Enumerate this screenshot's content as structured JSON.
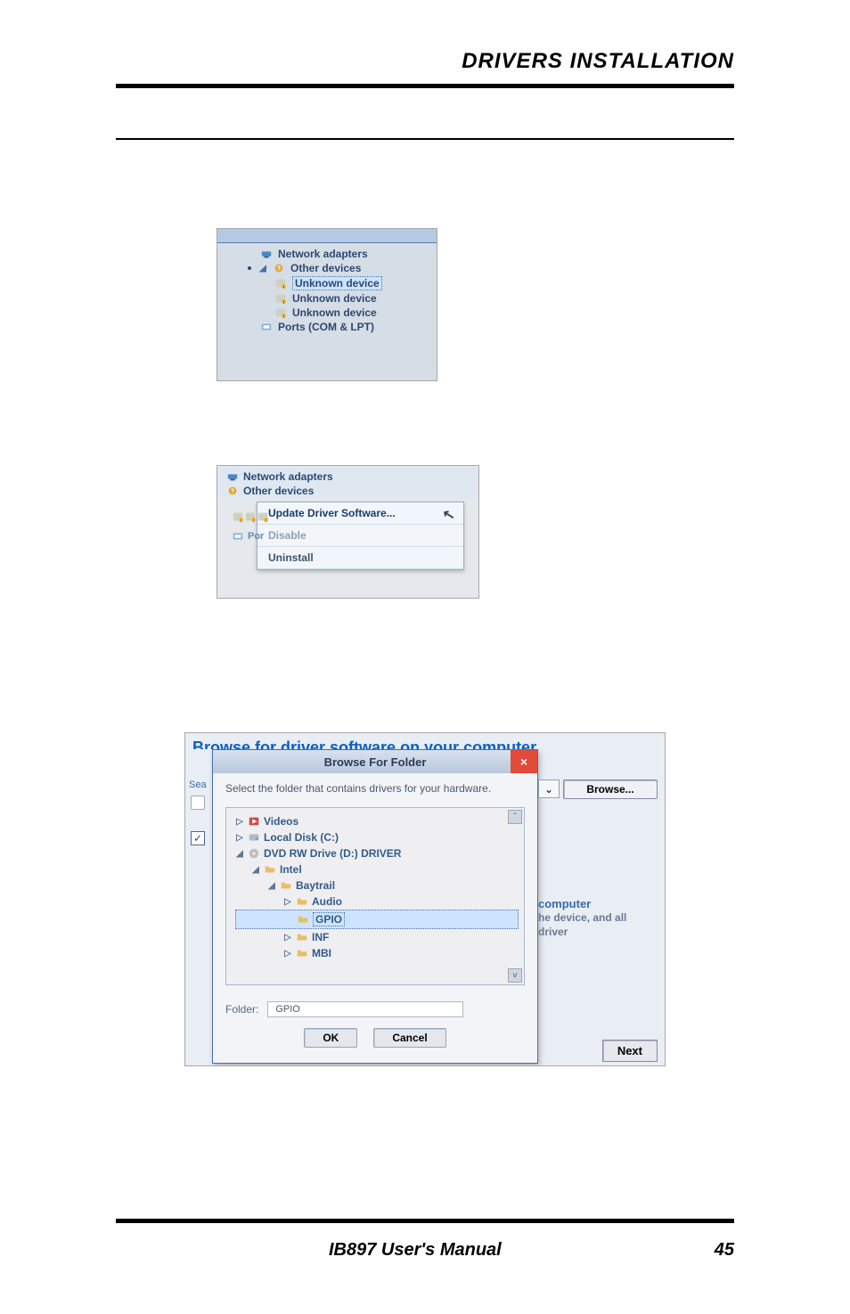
{
  "header": {
    "title": "DRIVERS INSTALLATION"
  },
  "footer": {
    "center": "IB897 User's Manual",
    "right": "45"
  },
  "img1": {
    "top_strip": " ",
    "rows": [
      {
        "twist": " ",
        "icon": "network-adapter-icon",
        "label": "Network adapters",
        "indent": 1
      },
      {
        "twist": "◢",
        "icon": "other-devices-icon",
        "label": "Other devices",
        "indent": 1,
        "bullet": true
      },
      {
        "twist": " ",
        "icon": "unknown-device-icon",
        "label": "Unknown device",
        "indent": 2,
        "selected": true
      },
      {
        "twist": " ",
        "icon": "unknown-device-icon",
        "label": "Unknown device",
        "indent": 2
      },
      {
        "twist": " ",
        "icon": "unknown-device-icon",
        "label": "Unknown device",
        "indent": 2
      },
      {
        "twist": " ",
        "icon": "ports-icon",
        "label": "Ports (COM & LPT)",
        "indent": 1
      }
    ]
  },
  "img2": {
    "rows": [
      {
        "icon": "network-adapter-icon",
        "label": "Network adapters"
      },
      {
        "icon": "other-devices-icon",
        "label": "Other devices"
      }
    ],
    "por_label": "Por",
    "menu": [
      {
        "label": "Update Driver Software...",
        "kind": "top"
      },
      {
        "label": "Disable",
        "kind": "dim"
      },
      {
        "label": "Uninstall",
        "kind": "normal"
      }
    ]
  },
  "img3": {
    "outer_title": "Browse for driver software on your computer",
    "left_fragment": {
      "sea_text": "Sea",
      "checkbox_checked": true
    },
    "right": {
      "dropdown_glyph": "⌄",
      "browse_label": "Browse...",
      "trunc1": "computer",
      "trunc2": "he device, and all driver",
      "next_label": "Next"
    },
    "dialog": {
      "title": "Browse For Folder",
      "close_glyph": "×",
      "message": "Select the folder that contains drivers for your hardware.",
      "scroll_up": "ˆ",
      "scroll_dn": "˅",
      "tree": [
        {
          "indent": 0,
          "twist": "▷",
          "icon": "videos-icon",
          "label": "Videos"
        },
        {
          "indent": 0,
          "twist": "▷",
          "icon": "disk-icon",
          "label": "Local Disk (C:)"
        },
        {
          "indent": 0,
          "twist": "◢",
          "icon": "dvd-icon",
          "label": "DVD RW Drive (D:) DRIVER"
        },
        {
          "indent": 1,
          "twist": "◢",
          "icon": "folder-icon",
          "label": "Intel"
        },
        {
          "indent": 2,
          "twist": "◢",
          "icon": "folder-icon",
          "label": "Baytrail"
        },
        {
          "indent": 3,
          "twist": "▷",
          "icon": "folder-icon",
          "label": "Audio"
        },
        {
          "indent": 3,
          "twist": " ",
          "icon": "folder-icon",
          "label": "GPIO",
          "selected": true
        },
        {
          "indent": 3,
          "twist": "▷",
          "icon": "folder-icon",
          "label": "INF"
        },
        {
          "indent": 3,
          "twist": "▷",
          "icon": "folder-icon",
          "label": "MBI"
        }
      ],
      "folder_label": "Folder:",
      "folder_value": "GPIO",
      "ok_label": "OK",
      "cancel_label": "Cancel"
    }
  }
}
